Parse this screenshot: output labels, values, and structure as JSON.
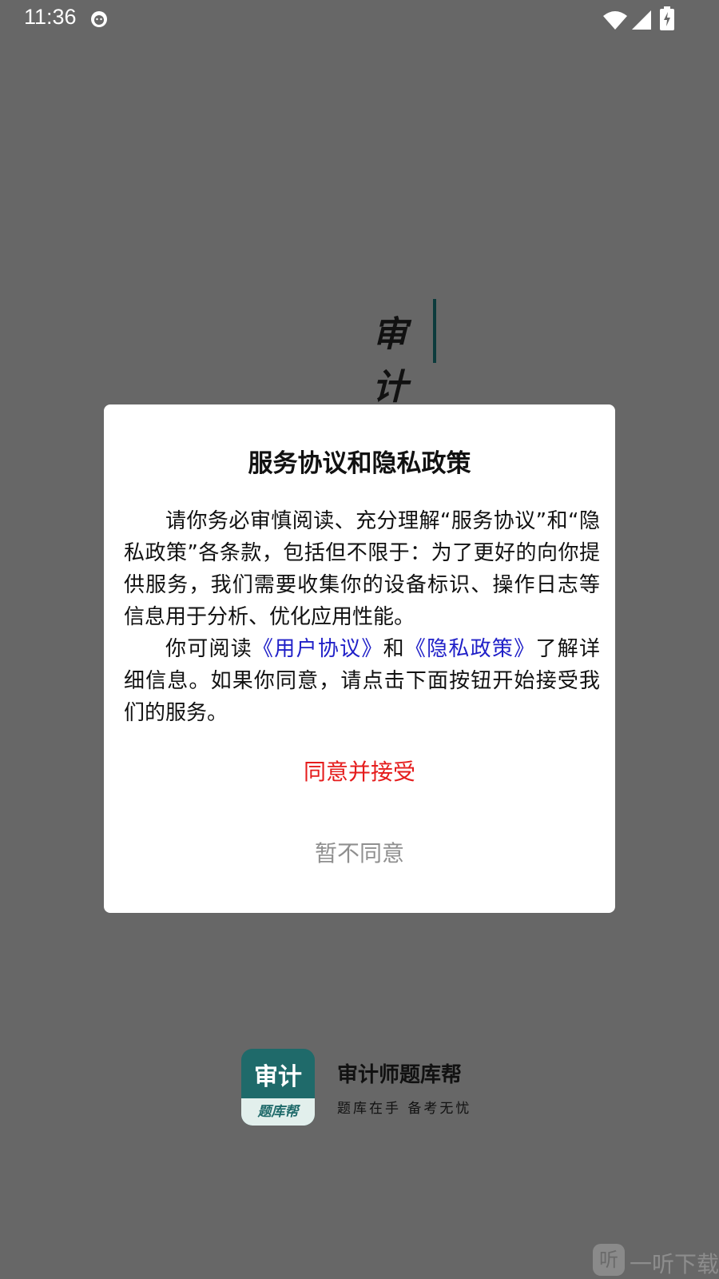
{
  "status_bar": {
    "time": "11:36",
    "icons": [
      "cat-icon",
      "wifi-icon",
      "signal-icon",
      "battery-charging-icon"
    ]
  },
  "splash": {
    "title_char1": "审",
    "title_char2": "计"
  },
  "dialog": {
    "title": "服务协议和隐私政策",
    "para1": "请你务必审慎阅读、充分理解“服务协议”和“隐私政策”各条款，包括但不限于：为了更好的向你提供服务，我们需要收集你的设备标识、操作日志等信息用于分析、优化应用性能。",
    "para2_prefix": "你可阅读",
    "link_user_agreement": "《用户协议》",
    "para2_and": "和",
    "link_privacy_policy": "《隐私政策》",
    "para2_suffix": "了解详细信息。如果你同意，请点击下面按钮开始接受我们的服务。",
    "agree_label": "同意并接受",
    "decline_label": "暂不同意"
  },
  "brand": {
    "logo_main": "审计",
    "logo_sub": "题库帮",
    "app_name": "审计师题库帮",
    "slogan": "题库在手 备考无忧"
  },
  "watermark": {
    "icon_text": "听",
    "text": "一听下载"
  },
  "colors": {
    "overlay_bg": "#676767",
    "agree": "#e51c1c",
    "decline": "#8f8f8f",
    "link": "#2020c8",
    "brand": "#1f6a6a"
  }
}
